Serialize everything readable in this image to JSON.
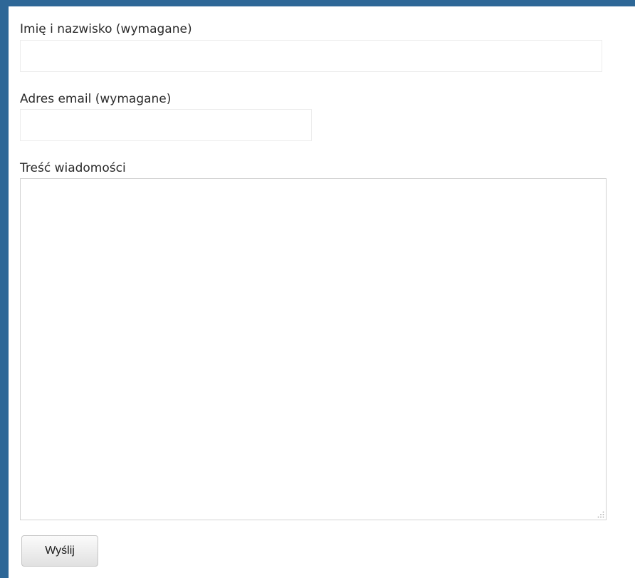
{
  "form": {
    "name_label": "Imię i nazwisko (wymagane)",
    "name_value": "",
    "email_label": "Adres email (wymagane)",
    "email_value": "",
    "message_label": "Treść wiadomości",
    "message_value": "",
    "submit_label": "Wyślij"
  },
  "colors": {
    "background": "#2e6797",
    "panel": "#ffffff"
  },
  "icons": {
    "resize_grip": "resize-grip-icon"
  }
}
